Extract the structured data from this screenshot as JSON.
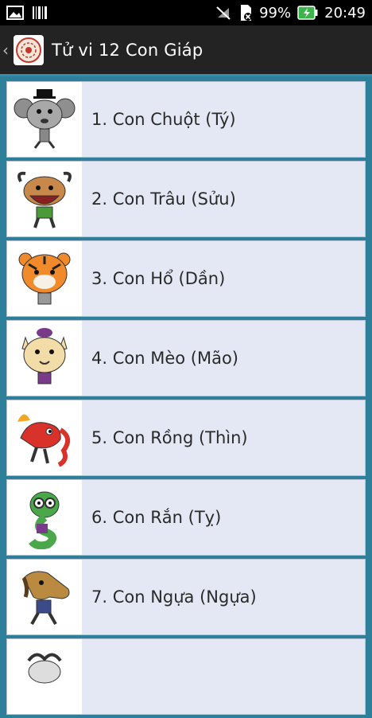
{
  "status_bar": {
    "battery_percent": "99%",
    "time": "20:49",
    "icons": [
      "image-icon",
      "barcode-icon",
      "mute-icon",
      "sdcard-icon",
      "battery-charging-icon"
    ]
  },
  "action_bar": {
    "title": "Tử vi 12 Con Giáp",
    "up_icon": "chevron-left-icon",
    "app_icon": "zodiac-wheel-icon"
  },
  "items": [
    {
      "label": "1. Con Chuột (Tý)",
      "icon": "rat-cartoon-icon",
      "color": "#9a9a9a"
    },
    {
      "label": "2. Con Trâu (Sửu)",
      "icon": "ox-cartoon-icon",
      "color": "#c7884a"
    },
    {
      "label": "3. Con Hổ (Dần)",
      "icon": "tiger-cartoon-icon",
      "color": "#f08a2a"
    },
    {
      "label": "4. Con Mèo (Mão)",
      "icon": "cat-cartoon-icon",
      "color": "#f2dca7"
    },
    {
      "label": "5. Con Rồng (Thìn)",
      "icon": "dragon-cartoon-icon",
      "color": "#d8322b"
    },
    {
      "label": "6. Con Rắn (Tỵ)",
      "icon": "snake-cartoon-icon",
      "color": "#4aa84a"
    },
    {
      "label": "7. Con Ngựa (Ngựa)",
      "icon": "horse-cartoon-icon",
      "color": "#b98a3f"
    },
    {
      "label": "",
      "icon": "goat-cartoon-icon",
      "color": "#bbbbbb"
    }
  ]
}
